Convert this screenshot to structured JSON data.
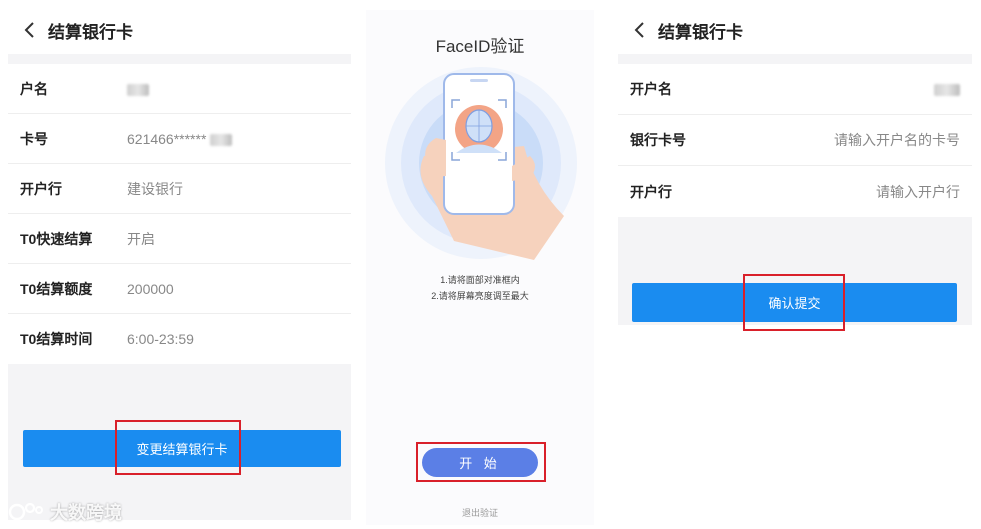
{
  "panel1": {
    "header": {
      "title": "结算银行卡"
    },
    "rows": [
      {
        "label": "户名",
        "value": ""
      },
      {
        "label": "卡号",
        "value": "621466******"
      },
      {
        "label": "开户行",
        "value": "建设银行"
      },
      {
        "label": "T0快速结算",
        "value": "开启"
      },
      {
        "label": "T0结算额度",
        "value": "200000"
      },
      {
        "label": "T0结算时间",
        "value": "6:00-23:59"
      }
    ],
    "change_button": "变更结算银行卡"
  },
  "panel2": {
    "title": "FaceID验证",
    "tips": [
      "1.请将面部对准框内",
      "2.请将屏幕亮度调至最大"
    ],
    "start_button": "开 始",
    "exit_link": "退出验证"
  },
  "panel3": {
    "header": {
      "title": "结算银行卡"
    },
    "rows": [
      {
        "label": "开户名",
        "placeholder": ""
      },
      {
        "label": "银行卡号",
        "placeholder": "请输入开户名的卡号"
      },
      {
        "label": "开户行",
        "placeholder": "请输入开户行"
      }
    ],
    "confirm_button": "确认提交"
  },
  "watermark": {
    "text": "大数跨境"
  },
  "colors": {
    "primary": "#1a8cf0",
    "start_button": "#5b7fe6",
    "highlight_box": "#d9202a"
  },
  "icons": [
    "chevron-left-icon",
    "face-scan-icon",
    "watermark-logo-icon"
  ]
}
